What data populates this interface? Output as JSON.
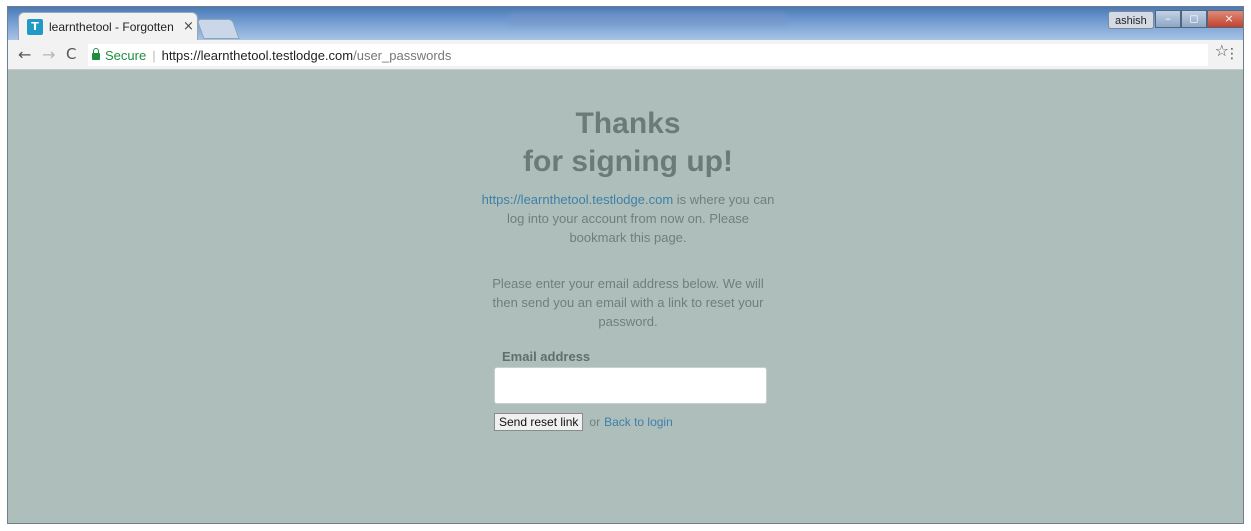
{
  "browser": {
    "tab": {
      "favicon": "learnthetool-favicon",
      "title": "learnthetool - Forgotten",
      "close": "×"
    },
    "profile_name": "ashish",
    "window_buttons": [
      "–",
      "◻",
      "×"
    ],
    "nav": {
      "back": "←",
      "forward": "→",
      "reload": "C"
    },
    "address": {
      "secure_label": "Secure",
      "url_host": "https://learnthetool.testlodge.com",
      "url_path": "/user_passwords",
      "star": "☆",
      "menu": "⋮"
    }
  },
  "page": {
    "heading_line1": "Thanks",
    "heading_line2": "for signing up!",
    "intro_link": "https://learnthetool.testlodge.com",
    "intro_text": " is where you can log into your account from now on. Please bookmark this page.",
    "instructions": "Please enter your email address below. We will then send you an email with a link to reset your password.",
    "email_label": "Email address",
    "email_value": "",
    "submit_label": "Send reset link",
    "or_text": "or",
    "back_link": "Back to login"
  },
  "colors": {
    "page_background": "#aebfbb",
    "link": "#3f7fa8",
    "heading": "#6b7c77"
  }
}
